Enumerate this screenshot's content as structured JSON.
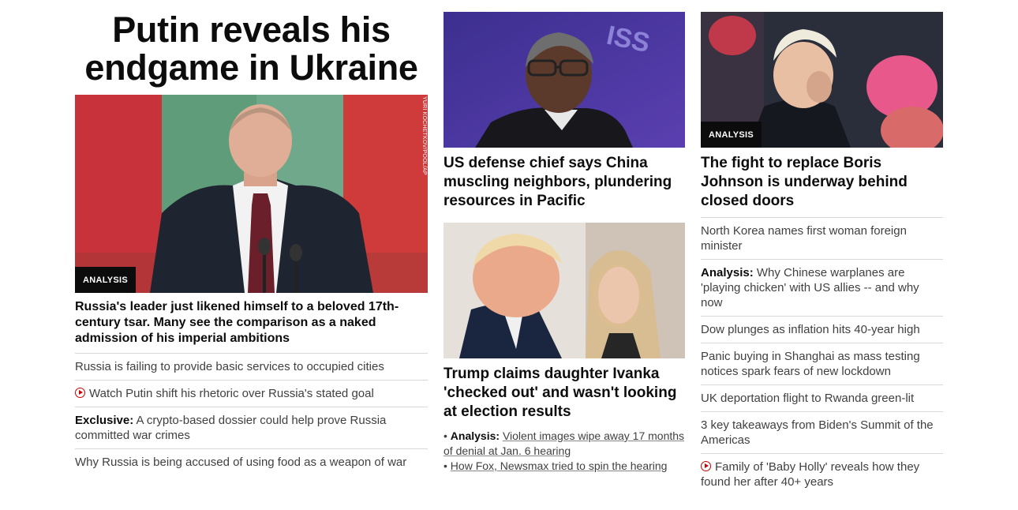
{
  "left": {
    "hero_title": "Putin reveals his endgame in Ukraine",
    "photo_credit": "YURI KOCHETKOV/POOL/AP",
    "badge": "ANALYSIS",
    "headline": "Russia's leader just likened himself to a beloved 17th-century tsar. Many see the comparison as a naked admission of his imperial ambitions",
    "links": [
      {
        "prefix": "",
        "text": "Russia is failing to provide basic services to occupied cities",
        "video": false
      },
      {
        "prefix": "",
        "text": "Watch Putin shift his rhetoric over Russia's stated goal",
        "video": true
      },
      {
        "prefix": "Exclusive:",
        "text": " A crypto-based dossier could help prove Russia committed war crimes",
        "video": false
      },
      {
        "prefix": "",
        "text": "Why Russia is being accused of using food as a weapon of war",
        "video": false
      }
    ]
  },
  "middle": {
    "story1": {
      "image_text": "ISS",
      "headline": "US defense chief says China muscling neighbors, plundering resources in Pacific"
    },
    "story2": {
      "headline": "Trump claims daughter Ivanka 'checked out' and wasn't looking at election results",
      "sublinks": [
        {
          "bullet": "•",
          "prefix": "Analysis:",
          "text": "Violent images wipe away 17 months of denial at Jan. 6 hearing"
        },
        {
          "bullet": "•",
          "prefix": "",
          "text": "How Fox, Newsmax tried to spin the hearing"
        }
      ]
    }
  },
  "right": {
    "badge": "ANALYSIS",
    "headline": "The fight to replace Boris Johnson is underway behind closed doors",
    "links": [
      {
        "prefix": "",
        "text": "North Korea names first woman foreign minister",
        "video": false
      },
      {
        "prefix": "Analysis:",
        "text": " Why Chinese warplanes are 'playing chicken' with US allies -- and why now",
        "video": false
      },
      {
        "prefix": "",
        "text": "Dow plunges as inflation hits 40-year high",
        "video": false
      },
      {
        "prefix": "",
        "text": "Panic buying in Shanghai as mass testing notices spark fears of new lockdown",
        "video": false
      },
      {
        "prefix": "",
        "text": "UK deportation flight to Rwanda green-lit",
        "video": false
      },
      {
        "prefix": "",
        "text": "3 key takeaways from Biden's Summit of the Americas",
        "video": false
      },
      {
        "prefix": "",
        "text": "Family of 'Baby Holly' reveals how they found her after 40+ years",
        "video": true
      }
    ]
  },
  "colors": {
    "video_icon": "#cc0000",
    "badge_bg": "#0c0c0c",
    "divider": "#d9d9d9"
  },
  "icons": {
    "video": "play-circle-icon"
  }
}
